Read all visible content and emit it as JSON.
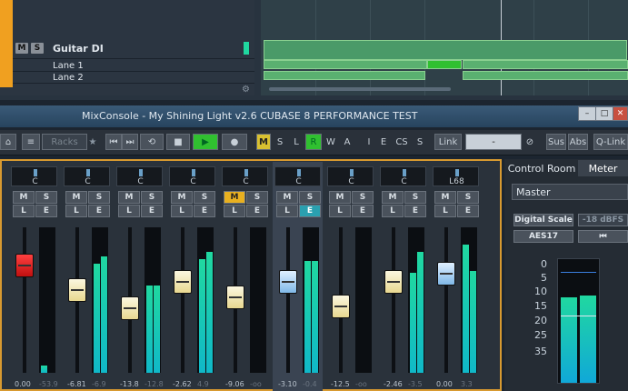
{
  "project": {
    "tracks": [
      {
        "name": "Guitar DI",
        "m": "M",
        "s": "S"
      },
      {
        "name": "Lane 1"
      },
      {
        "name": "Lane 2"
      }
    ]
  },
  "window": {
    "title": "MixConsole - My Shining Light v2.6 CUBASE 8 PERFORMANCE TEST",
    "btn_min": "–",
    "btn_max": "□",
    "btn_close": "✕"
  },
  "toolbar": {
    "racks": "Racks",
    "modes": [
      "M",
      "S",
      "L",
      "R",
      "W",
      "A"
    ],
    "flags": [
      "I",
      "E",
      "CS",
      "S"
    ],
    "link": "Link",
    "link_value": "-",
    "sus": "Sus",
    "abs": "Abs",
    "qlink": "Q-Link"
  },
  "channels": [
    {
      "pan": "C",
      "value": "0.00",
      "peak": "-53.9",
      "fader": 0.78,
      "meter": [
        0.05,
        0.0
      ],
      "cap": "red"
    },
    {
      "pan": "C",
      "value": "-6.81",
      "peak": "-6.9",
      "fader": 0.58,
      "meter": [
        0.75,
        0.8
      ],
      "cap": "white"
    },
    {
      "pan": "C",
      "value": "-13.8",
      "peak": "-12.8",
      "fader": 0.43,
      "meter": [
        0.6,
        0.6
      ],
      "cap": "white"
    },
    {
      "pan": "C",
      "value": "-2.62",
      "peak": "4.9",
      "fader": 0.65,
      "meter": [
        0.78,
        0.83
      ],
      "cap": "white"
    },
    {
      "pan": "C",
      "value": "-9.06",
      "peak": "-oo",
      "fader": 0.52,
      "meter": [
        0.0,
        0.0
      ],
      "cap": "white",
      "monitor": true
    },
    {
      "pan": "C",
      "value": "-3.10",
      "peak": "-0.4",
      "fader": 0.65,
      "meter": [
        0.77,
        0.77
      ],
      "cap": "blue",
      "selected": true,
      "edit": true
    },
    {
      "pan": "C",
      "value": "-12.5",
      "peak": "-oo",
      "fader": 0.45,
      "meter": [
        0.0,
        0.0
      ],
      "cap": "white"
    },
    {
      "pan": "C",
      "value": "-2.46",
      "peak": "-3.5",
      "fader": 0.65,
      "meter": [
        0.69,
        0.83
      ],
      "cap": "white"
    },
    {
      "pan": "L68",
      "value": "0.00",
      "peak": "3.3",
      "fader": 0.72,
      "meter": [
        0.88,
        0.7
      ],
      "cap": "blue"
    }
  ],
  "channel_buttons": {
    "m": "M",
    "s": "S",
    "l": "L",
    "e": "E"
  },
  "right_panel": {
    "tabs": [
      "Control Room",
      "Meter"
    ],
    "output": "Master",
    "digital_scale": "Digital Scale",
    "dbfs": "-18 dBFS",
    "aes": "AES17",
    "reset": "⏮",
    "scale": [
      "0",
      "5",
      "10",
      "15",
      "20",
      "25",
      "35"
    ],
    "meter": [
      0.7,
      0.72
    ]
  }
}
